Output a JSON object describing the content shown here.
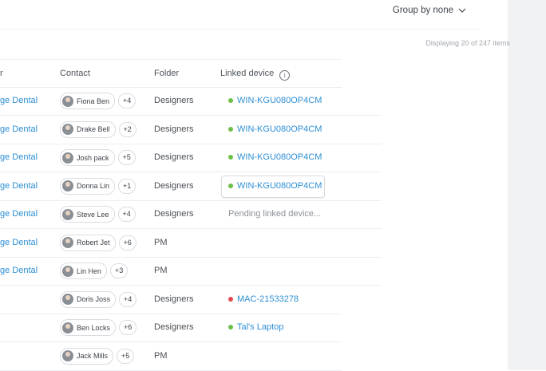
{
  "group_by": {
    "label": "Group by none"
  },
  "displaying": "Displaying 20 of 247 items",
  "columns": {
    "company": "r",
    "contact": "Contact",
    "folder": "Folder",
    "linked_device": "Linked device"
  },
  "colors": {
    "accent": "#2d8fd5",
    "online": "#6cc04a",
    "offline": "#e5484d"
  },
  "rows": [
    {
      "company": "ge Dental",
      "contact": "Fiona Ben",
      "extra": "+4",
      "folder": "Designers",
      "device": "WIN-KGU080OP4CM",
      "status": "online"
    },
    {
      "company": "ge Dental",
      "contact": "Drake Bell",
      "extra": "+2",
      "folder": "Designers",
      "device": "WIN-KGU080OP4CM",
      "status": "online"
    },
    {
      "company": "ge Dental",
      "contact": "Josh pack",
      "extra": "+5",
      "folder": "Designers",
      "device": "WIN-KGU080OP4CM",
      "status": "online"
    },
    {
      "company": "ge Dental",
      "contact": "Donna Lin",
      "extra": "+1",
      "folder": "Designers",
      "device": "WIN-KGU080OP4CM",
      "status": "online",
      "boxed": true
    },
    {
      "company": "ge Dental",
      "contact": "Steve Lee",
      "extra": "+4",
      "folder": "Designers",
      "device": "Pending linked device...",
      "status": "pending"
    },
    {
      "company": "ge Dental",
      "contact": "Robert Jet",
      "extra": "+6",
      "folder": "PM",
      "device": "",
      "status": "none"
    },
    {
      "company": "ge Dental",
      "contact": "Lin Hen",
      "extra": "+3",
      "folder": "PM",
      "device": "",
      "status": "none"
    },
    {
      "company": "",
      "contact": "Doris Joss",
      "extra": "+4",
      "folder": "Designers",
      "device": "MAC-21533278",
      "status": "offline"
    },
    {
      "company": "",
      "contact": "Ben Locks",
      "extra": "+6",
      "folder": "Designers",
      "device": "Tal's Laptop",
      "status": "online"
    },
    {
      "company": "",
      "contact": "Jack Mills",
      "extra": "+5",
      "folder": "PM",
      "device": "",
      "status": "none"
    }
  ]
}
